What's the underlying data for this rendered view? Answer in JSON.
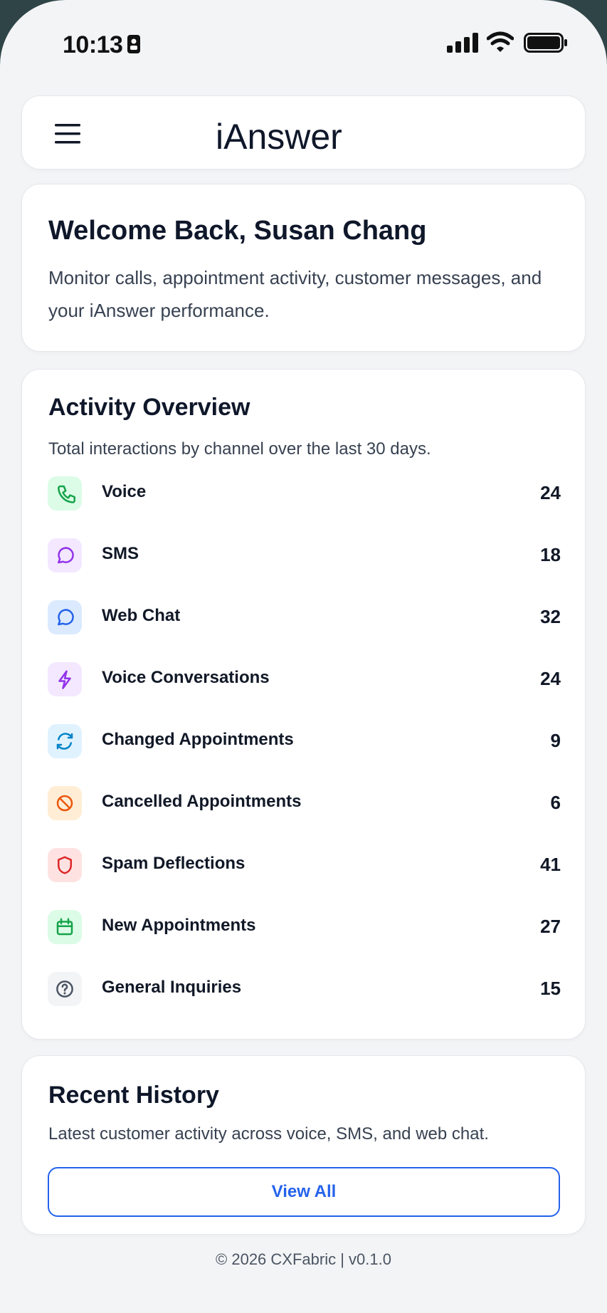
{
  "status_bar": {
    "time": "10:13",
    "icons": [
      "sim-card-icon",
      "signal-icon",
      "wifi-icon",
      "battery-icon"
    ]
  },
  "header": {
    "logo_text": "iAnswer",
    "menu_icon": "hamburger-menu-icon"
  },
  "welcome": {
    "title": "Welcome Back, Susan Chang",
    "subtitle": "Monitor calls, appointment activity, customer messages, and your iAnswer performance."
  },
  "activity": {
    "title": "Activity Overview",
    "subtitle": "Total interactions by channel over the last 30 days.",
    "items": [
      {
        "label": "Voice",
        "count": "24",
        "icon": "phone-icon",
        "bg": "#dcfce7",
        "fg": "#16a34a"
      },
      {
        "label": "SMS",
        "count": "18",
        "icon": "message-circle-icon",
        "bg": "#f3e8ff",
        "fg": "#9333ea"
      },
      {
        "label": "Web Chat",
        "count": "32",
        "icon": "chat-bubble-icon",
        "bg": "#dbeafe",
        "fg": "#2563eb"
      },
      {
        "label": "Voice Conversations",
        "count": "24",
        "icon": "lightning-icon",
        "bg": "#f3e8ff",
        "fg": "#9333ea"
      },
      {
        "label": "Changed Appointments",
        "count": "9",
        "icon": "refresh-icon",
        "bg": "#e0f2fe",
        "fg": "#0284c7"
      },
      {
        "label": "Cancelled Appointments",
        "count": "6",
        "icon": "ban-icon",
        "bg": "#ffedd5",
        "fg": "#ea580c"
      },
      {
        "label": "Spam Deflections",
        "count": "41",
        "icon": "shield-icon",
        "bg": "#fee2e2",
        "fg": "#dc2626"
      },
      {
        "label": "New Appointments",
        "count": "27",
        "icon": "calendar-icon",
        "bg": "#dcfce7",
        "fg": "#16a34a"
      },
      {
        "label": "General Inquiries",
        "count": "15",
        "icon": "help-circle-icon",
        "bg": "#f3f4f6",
        "fg": "#4b5563"
      }
    ]
  },
  "history": {
    "title": "Recent History",
    "subtitle": "Latest customer activity across voice, SMS, and web chat.",
    "view_all_label": "View All"
  },
  "footer": {
    "text": "© 2026 CXFabric | v0.1.0"
  },
  "colors": {
    "accent": "#2563eb",
    "background": "#f3f4f6",
    "card": "#ffffff",
    "text": "#0f172a"
  }
}
